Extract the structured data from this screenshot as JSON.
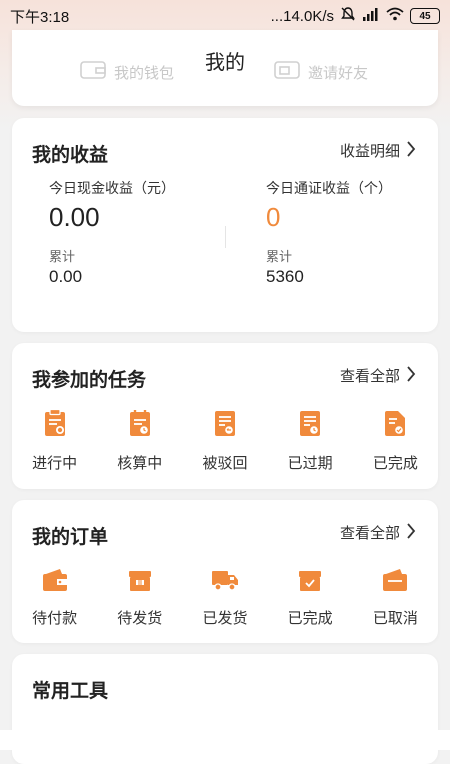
{
  "status_bar": {
    "time": "下午3:18",
    "network_speed": "...14.0K/s",
    "battery": "45"
  },
  "header": {
    "title": "我的",
    "wallet_label": "我的钱包",
    "invite_label": "邀请好友"
  },
  "earnings": {
    "title": "我的收益",
    "detail_link": "收益明细",
    "cash_today_label": "今日现金收益（元）",
    "cash_today_value": "0.00",
    "cash_total_label": "累计",
    "cash_total_value": "0.00",
    "token_today_label": "今日通证收益（个）",
    "token_today_value": "0",
    "token_total_label": "累计",
    "token_total_value": "5360"
  },
  "tasks": {
    "title": "我参加的任务",
    "view_all": "查看全部",
    "items": [
      {
        "label": "进行中",
        "icon": "clipboard-in-progress-icon"
      },
      {
        "label": "核算中",
        "icon": "calendar-accounting-icon"
      },
      {
        "label": "被驳回",
        "icon": "document-rejected-icon"
      },
      {
        "label": "已过期",
        "icon": "document-expired-icon"
      },
      {
        "label": "已完成",
        "icon": "document-completed-icon"
      }
    ]
  },
  "orders": {
    "title": "我的订单",
    "view_all": "查看全部",
    "items": [
      {
        "label": "待付款",
        "icon": "wallet-icon"
      },
      {
        "label": "待发货",
        "icon": "package-icon"
      },
      {
        "label": "已发货",
        "icon": "truck-icon"
      },
      {
        "label": "已完成",
        "icon": "box-check-icon"
      },
      {
        "label": "已取消",
        "icon": "wallet-cancel-icon"
      }
    ]
  },
  "tools": {
    "title": "常用工具"
  },
  "colors": {
    "accent": "#f08a3c",
    "background": "#f2f2f2"
  }
}
